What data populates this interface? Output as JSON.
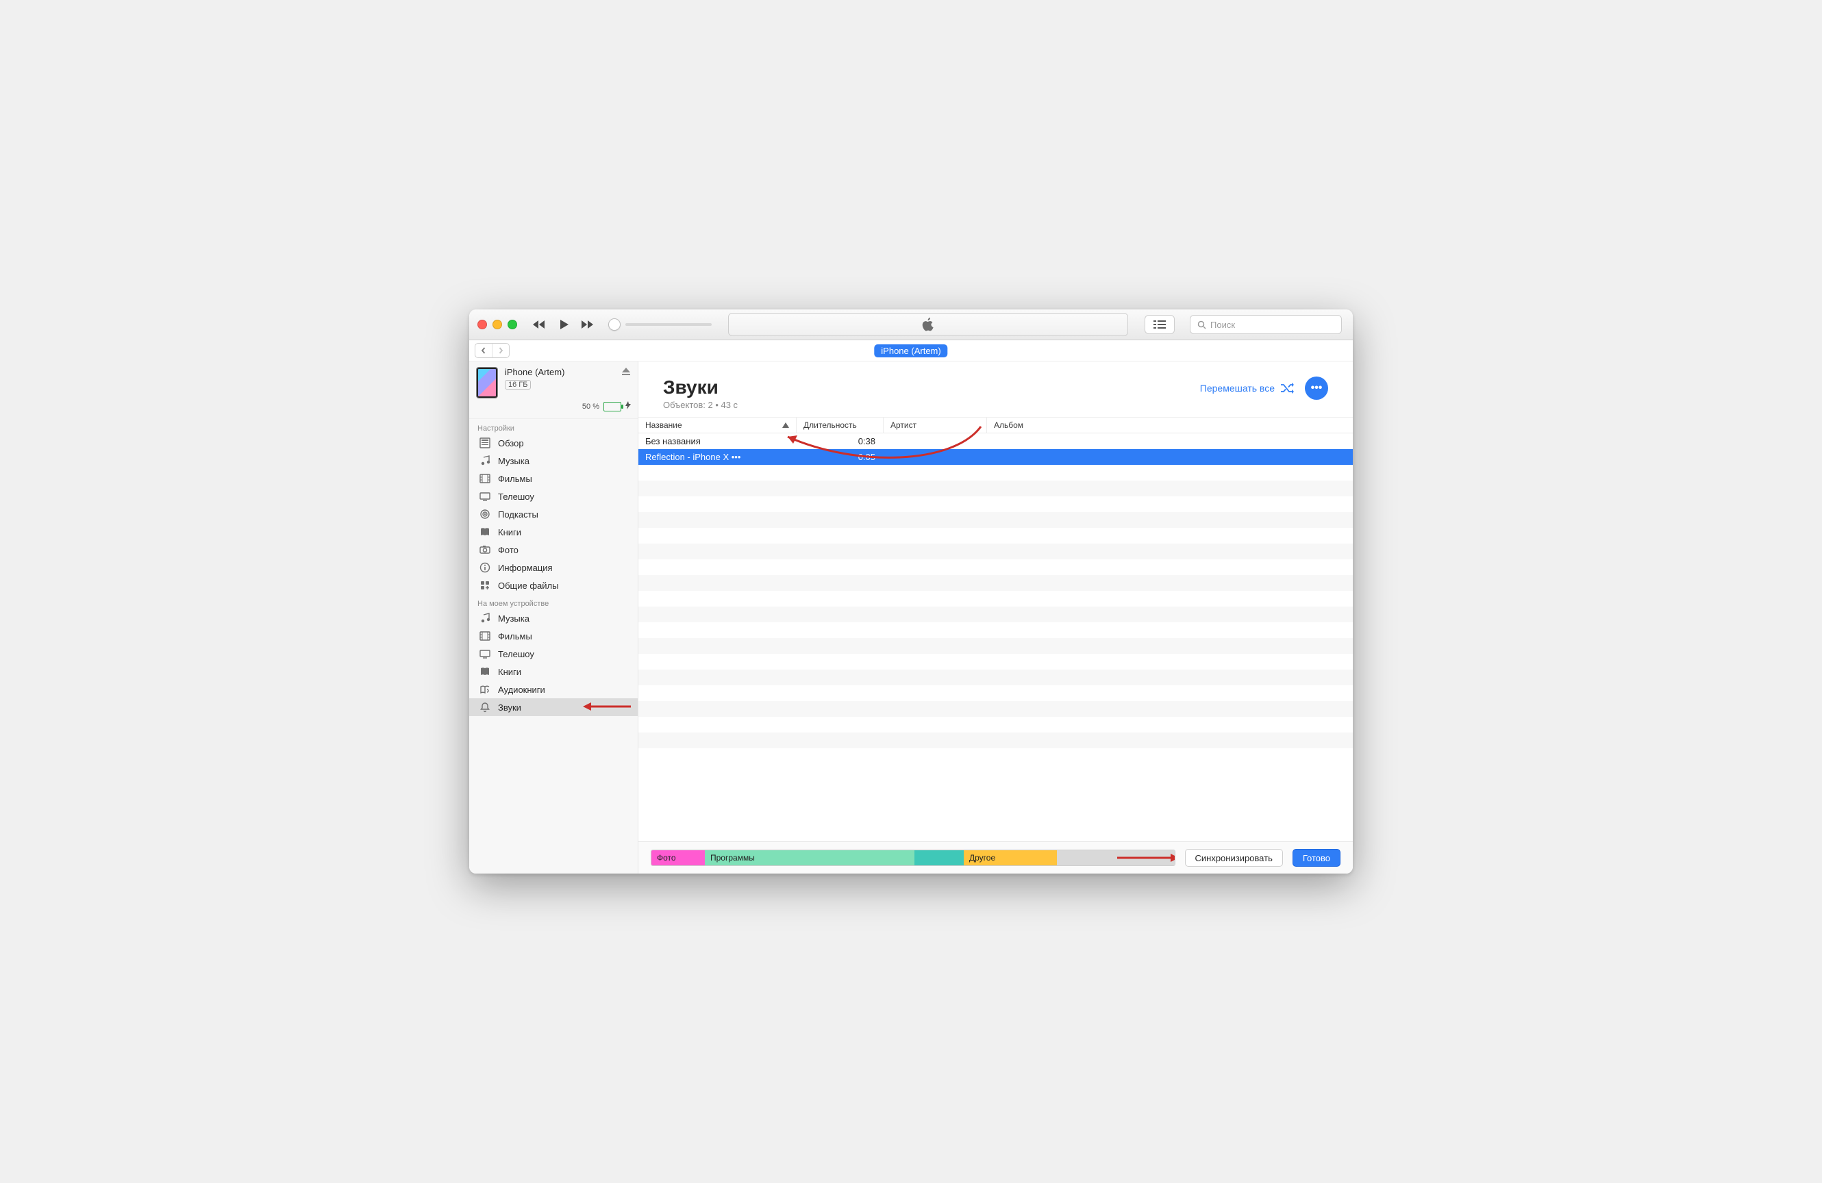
{
  "toolbar": {
    "search_placeholder": "Поиск"
  },
  "breadcrumb": {
    "label": "iPhone (Artem)"
  },
  "device": {
    "name": "iPhone (Artem)",
    "capacity": "16 ГБ",
    "battery_percent_label": "50 %"
  },
  "sidebar": {
    "settings_label": "Настройки",
    "settings": [
      {
        "label": "Обзор",
        "icon": "summary"
      },
      {
        "label": "Музыка",
        "icon": "music"
      },
      {
        "label": "Фильмы",
        "icon": "film"
      },
      {
        "label": "Телешоу",
        "icon": "tv"
      },
      {
        "label": "Подкасты",
        "icon": "podcast"
      },
      {
        "label": "Книги",
        "icon": "books"
      },
      {
        "label": "Фото",
        "icon": "camera"
      },
      {
        "label": "Информация",
        "icon": "info"
      },
      {
        "label": "Общие файлы",
        "icon": "apps"
      }
    ],
    "ondevice_label": "На моем устройстве",
    "ondevice": [
      {
        "label": "Музыка",
        "icon": "music"
      },
      {
        "label": "Фильмы",
        "icon": "film"
      },
      {
        "label": "Телешоу",
        "icon": "tv"
      },
      {
        "label": "Книги",
        "icon": "books"
      },
      {
        "label": "Аудиокниги",
        "icon": "audiobook"
      },
      {
        "label": "Звуки",
        "icon": "bell"
      }
    ]
  },
  "content": {
    "title": "Звуки",
    "subtitle": "Объектов: 2 • 43 с",
    "shuffle_label": "Перемешать все",
    "columns": {
      "name": "Название",
      "duration": "Длительность",
      "artist": "Артист",
      "album": "Альбом"
    },
    "rows": [
      {
        "name": "Без названия",
        "duration": "0:38",
        "artist": "",
        "album": "",
        "selected": false
      },
      {
        "name": "Reflection - iPhone X •••",
        "duration": "0:05",
        "artist": "",
        "album": "",
        "selected": true
      }
    ]
  },
  "footer": {
    "photos": "Фото",
    "apps": "Программы",
    "other": "Другое",
    "sync": "Синхронизировать",
    "done": "Готово"
  },
  "annotations": {
    "sidebar_arrow_target_index": 5
  }
}
